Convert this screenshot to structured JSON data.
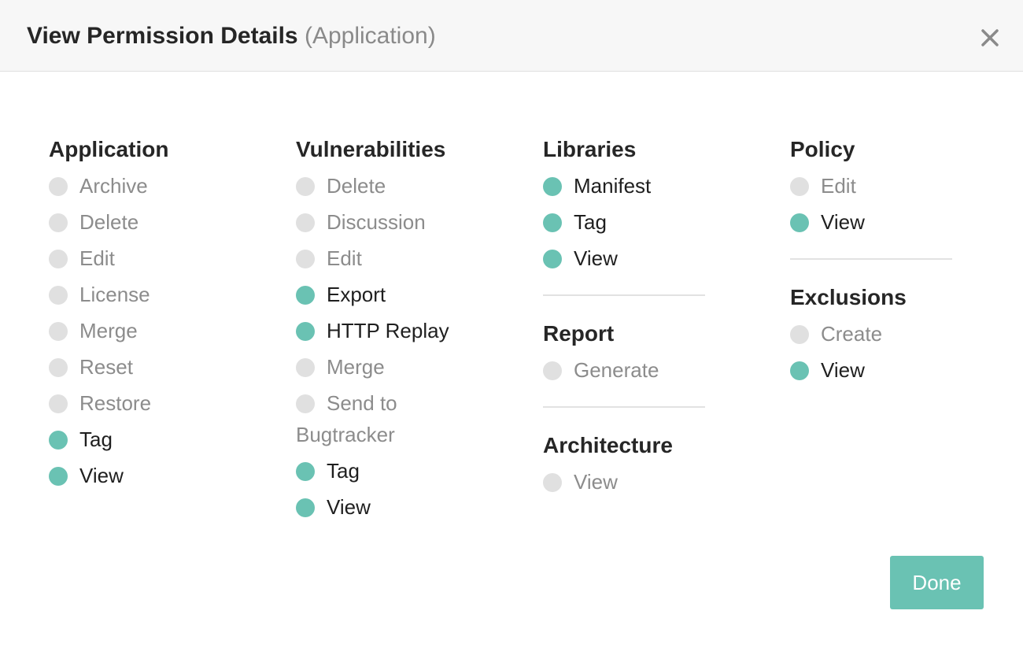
{
  "header": {
    "title": "View Permission Details",
    "subtitle": "(Application)",
    "close_icon": "close-icon"
  },
  "colors": {
    "enabled": "#6ac2b3",
    "disabled": "#e0e0e0",
    "header_bg": "#f7f7f7"
  },
  "columns": [
    {
      "sections": [
        {
          "title": "Application",
          "items": [
            {
              "label": "Archive",
              "enabled": false
            },
            {
              "label": "Delete",
              "enabled": false
            },
            {
              "label": "Edit",
              "enabled": false
            },
            {
              "label": "License",
              "enabled": false
            },
            {
              "label": "Merge",
              "enabled": false
            },
            {
              "label": "Reset",
              "enabled": false
            },
            {
              "label": "Restore",
              "enabled": false
            },
            {
              "label": "Tag",
              "enabled": true
            },
            {
              "label": "View",
              "enabled": true
            }
          ]
        }
      ]
    },
    {
      "sections": [
        {
          "title": "Vulnerabilities",
          "items": [
            {
              "label": "Delete",
              "enabled": false
            },
            {
              "label": "Discussion",
              "enabled": false
            },
            {
              "label": "Edit",
              "enabled": false
            },
            {
              "label": "Export",
              "enabled": true
            },
            {
              "label": "HTTP Replay",
              "enabled": true
            },
            {
              "label": "Merge",
              "enabled": false
            },
            {
              "label": "Send to Bugtracker",
              "label_line1": "Send to",
              "label_line2": "Bugtracker",
              "enabled": false
            },
            {
              "label": "Tag",
              "enabled": true
            },
            {
              "label": "View",
              "enabled": true
            }
          ]
        }
      ]
    },
    {
      "sections": [
        {
          "title": "Libraries",
          "items": [
            {
              "label": "Manifest",
              "enabled": true
            },
            {
              "label": "Tag",
              "enabled": true
            },
            {
              "label": "View",
              "enabled": true
            }
          ]
        },
        {
          "title": "Report",
          "items": [
            {
              "label": "Generate",
              "enabled": false
            }
          ]
        },
        {
          "title": "Architecture",
          "items": [
            {
              "label": "View",
              "enabled": false
            }
          ]
        }
      ]
    },
    {
      "sections": [
        {
          "title": "Policy",
          "items": [
            {
              "label": "Edit",
              "enabled": false
            },
            {
              "label": "View",
              "enabled": true
            }
          ]
        },
        {
          "title": "Exclusions",
          "items": [
            {
              "label": "Create",
              "enabled": false
            },
            {
              "label": "View",
              "enabled": true
            }
          ]
        }
      ]
    }
  ],
  "footer": {
    "done_label": "Done"
  }
}
